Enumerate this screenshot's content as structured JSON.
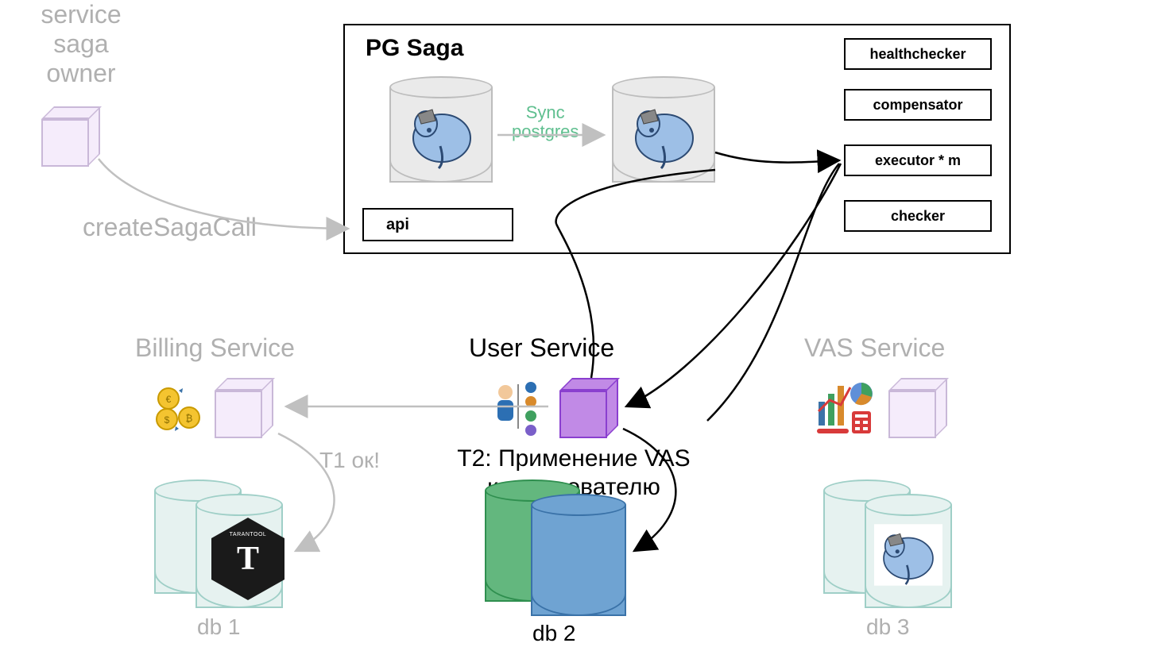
{
  "owner": {
    "line1": "service",
    "line2": "saga",
    "line3": "owner"
  },
  "call_label": "createSagaCall",
  "pgsaga": {
    "title": "PG Saga",
    "sync_label_line1": "Sync",
    "sync_label_line2": "postgres",
    "api_label": "api",
    "boxes": {
      "healthchecker": "healthchecker",
      "compensator": "compensator",
      "executor": "executor * m",
      "checker": "checker"
    }
  },
  "services": {
    "billing": {
      "title": "Billing Service",
      "db": "db 1",
      "t1": "T1 ок!"
    },
    "user": {
      "title": "User Service",
      "db": "db 2",
      "t2_line1": "T2: Применение VAS",
      "t2_line2": "к пользователю"
    },
    "vas": {
      "title": "VAS Service",
      "db": "db 3"
    }
  },
  "icons": {
    "tarantool_letter": "T",
    "tarantool_name": "TARANTOOL"
  }
}
